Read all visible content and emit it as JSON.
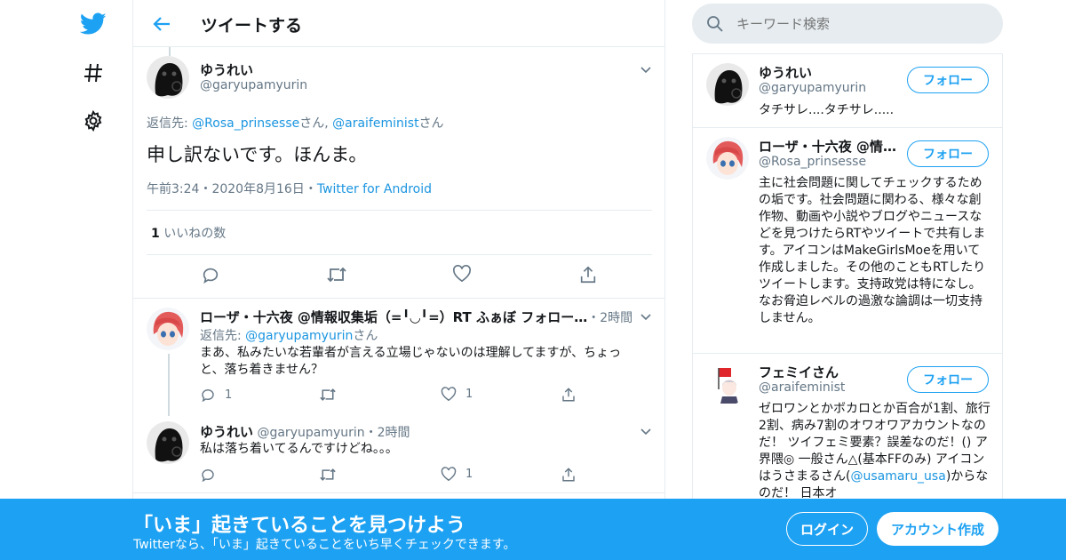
{
  "colors": {
    "accent": "#1da1f2",
    "link": "#1b95e0",
    "muted": "#657786",
    "border": "#e6ecf0"
  },
  "nav": {
    "icons": [
      "twitter-logo-icon",
      "hashtag-icon",
      "gear-icon"
    ]
  },
  "header": {
    "title": "ツイートする"
  },
  "main_tweet": {
    "name": "ゆうれい",
    "handle": "@garyupamyurin",
    "reply_prefix": "返信先: ",
    "reply_to_1": "@Rosa_prinsesse",
    "reply_sep_1": "さん, ",
    "reply_to_2": "@araifeminist",
    "reply_sep_2": "さん",
    "text": "申し訳ないです。ほんま。",
    "time": "午前3:24",
    "date": "2020年8月16日",
    "dot": "・",
    "source": "Twitter for Android",
    "likes_count": "1",
    "likes_label": " いいねの数"
  },
  "replies": [
    {
      "name": "ローザ・十六夜 @情報収集垢（=╹◡╹=）RT ふぁぼ フォロー…",
      "handle": "",
      "time": "・2時間",
      "reply_prefix": "返信先: ",
      "reply_to": "@garyupamyurin",
      "reply_suffix": "さん",
      "text": "まあ、私みたいな若輩者が言える立場じゃないのは理解してますが、ちょっと、落ち着きません？",
      "reply_count": "1",
      "like_count": "1"
    },
    {
      "name": "ゆうれい",
      "handle": "@garyupamyurin",
      "time": "・2時間",
      "text": "私は落ち着いてるんですけどね。。。",
      "reply_count": "",
      "like_count": "1"
    }
  ],
  "search": {
    "placeholder": "キーワード検索"
  },
  "users": [
    {
      "name": "ゆうれい",
      "handle": "@garyupamyurin",
      "bio": "タチサレ....タチサレ.....",
      "follow_label": "フォロー"
    },
    {
      "name": "ローザ・十六夜 @情報収集垢",
      "handle": "@Rosa_prinsesse",
      "bio": "主に社会問題に関してチェックするための垢です。社会問題に関わる、様々な創作物、動画や小説やブログやニュースなどを見つけたらRTやツイートで共有します。アイコンはMakeGirlsMoeを用いて作成しました。その他のこともRTしたりツイートします。支持政党は特になし。なお脅迫レベルの過激な論調は一切支持しません。",
      "follow_label": "フォロー"
    },
    {
      "name": "フェミイさん",
      "handle": "@araifeminist",
      "bio_1": "ゼロワンとかボカロとか百合が1割、旅行2割、病み7割のオワオワアカウントなのだ！ ツイフェミ要素？誤差なのだ！() ア界隈◎ 一般さん△(基本FFのみ) アイコンはうさまるさん(",
      "bio_link": "@usamaru_usa",
      "bio_2": ")からなのだ！ 日本オ",
      "follow_label": "フォロー"
    }
  ],
  "banner": {
    "title": "「いま」起きていることを見つけよう",
    "subtitle": "Twitterなら、「いま」起きていることをいち早くチェックできます。",
    "login_label": "ログイン",
    "signup_label": "アカウント作成"
  }
}
